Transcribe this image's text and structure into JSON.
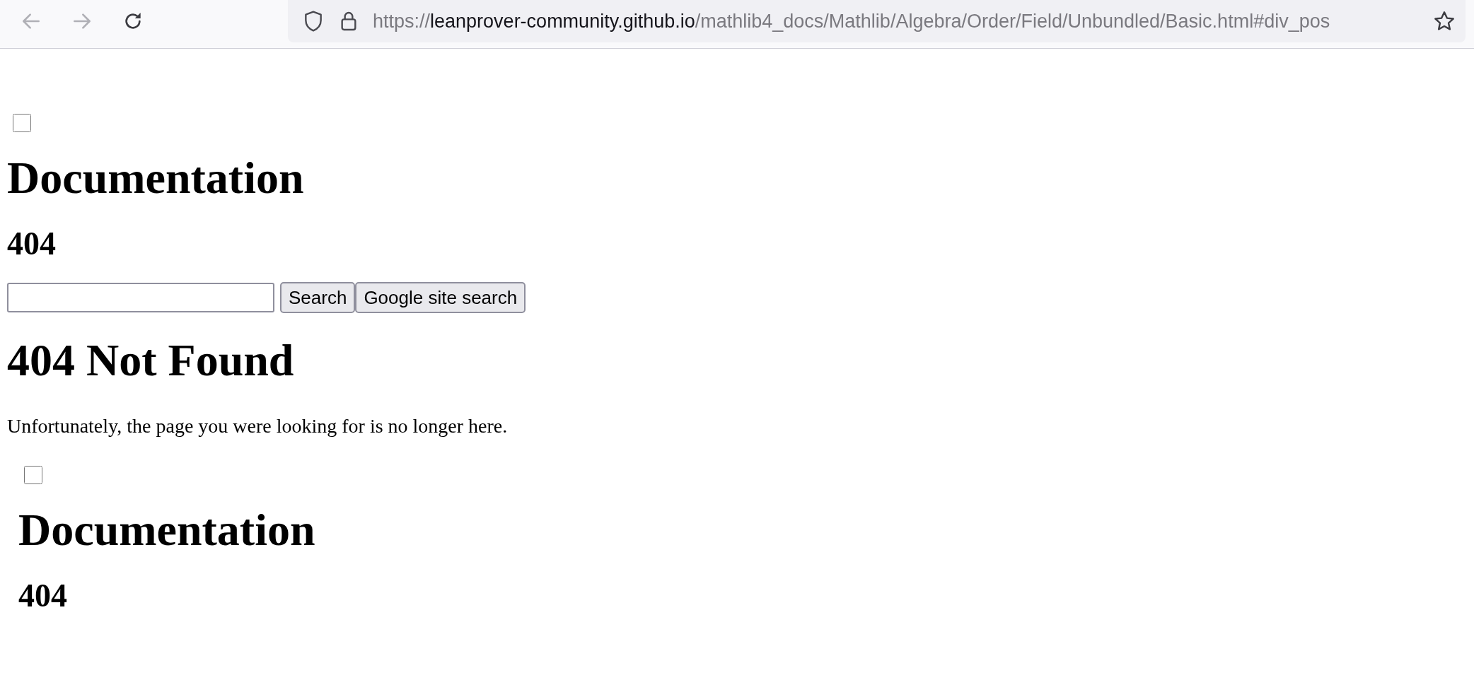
{
  "browser": {
    "url_scheme": "https://",
    "url_host": "leanprover-community.github.io",
    "url_path": "/mathlib4_docs/Mathlib/Algebra/Order/Field/Unbundled/Basic.html#div_pos"
  },
  "page": {
    "nav_toggle": {
      "checked": false
    },
    "title": "Documentation",
    "subtitle": "404",
    "search": {
      "button": "Search",
      "google_button": "Google site search"
    },
    "heading": "404 Not Found",
    "message": "Unfortunately, the page you were looking for is no longer here."
  },
  "nested_page": {
    "nav_toggle": {
      "checked": false
    },
    "title": "Documentation",
    "subtitle": "404"
  }
}
